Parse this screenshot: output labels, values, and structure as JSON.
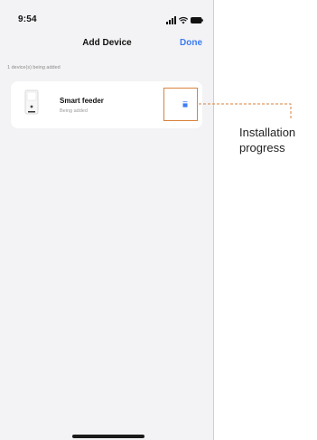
{
  "status_bar": {
    "time": "9:54"
  },
  "nav": {
    "title": "Add Device",
    "done_label": "Done"
  },
  "section": {
    "label": "1 device(s) being added"
  },
  "device": {
    "name": "Smart feeder",
    "status": "Being added"
  },
  "callout": {
    "line1": "Installation",
    "line2": "progress"
  },
  "colors": {
    "accent": "#3d7cf2",
    "highlight": "#d9823d",
    "background": "#f3f3f5"
  },
  "icons": {
    "signal": "signal-icon",
    "wifi": "wifi-icon",
    "battery": "battery-icon",
    "device": "smart-feeder-icon",
    "progress": "progress-icon"
  }
}
